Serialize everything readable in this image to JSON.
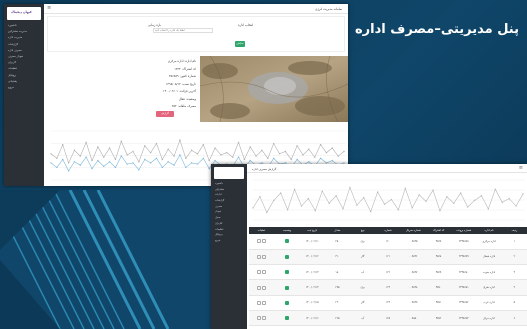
{
  "banner": {
    "title": "پنل مدیریتی–مصرف اداره"
  },
  "shot1": {
    "logo_text": "کیهان دیجیتال",
    "topbar_title": "سامانه مدیریت انرژی",
    "menu": [
      "داشبورد",
      "مدیریت مشترکین",
      "مدیریت اداره",
      "گزارشات",
      "مصرف اداره",
      "نمودار مصرف",
      "کاربران",
      "تنظیمات",
      "پروفایل",
      "پشتیبانی",
      "خروج"
    ],
    "form": {
      "label_unit": "انتخاب اداره",
      "label_date": "بازه زمانی",
      "input_value": "لطفا یک اداره را انتخاب کنید",
      "submit_label": "نمایش"
    },
    "info": {
      "lines": [
        "نام اداره: اداره مرکزی",
        "کد اشتراک: ۱۲۳۴",
        "شماره کنتور: ۴۵۶۷۸۹",
        "تاریخ نصب: ۱۳۹۸/۰۵/۱۲",
        "آخرین قرائت: ۱۴۰۰/۰۳/۰۱",
        "وضعیت: فعال",
        "مصرف ماهانه: ۲۵۴"
      ],
      "button_label": "گزارش"
    },
    "chart_data": {
      "type": "line",
      "series": [
        {
          "values": [
            52,
            48,
            60,
            44,
            55,
            50,
            62,
            46,
            58,
            49,
            57,
            47,
            63,
            51,
            54,
            45,
            59,
            53,
            61,
            47,
            56,
            50,
            64,
            48,
            55,
            52,
            60,
            46,
            57,
            51,
            53,
            49,
            62,
            47,
            58,
            50,
            55,
            48,
            61,
            52,
            54,
            47,
            59,
            51,
            56,
            49,
            60,
            53,
            57,
            50,
            54
          ]
        },
        {
          "values": [
            44,
            40,
            47,
            37,
            45,
            42,
            49,
            39,
            46,
            41,
            45,
            40,
            50,
            43,
            44,
            38,
            47,
            44,
            48,
            40,
            45,
            42,
            51,
            40,
            44,
            43,
            48,
            39,
            46,
            42,
            43,
            41,
            49,
            40,
            46,
            42,
            44,
            40,
            48,
            43,
            44,
            40,
            47,
            42,
            45,
            41,
            48,
            44,
            46,
            42,
            44
          ]
        }
      ]
    }
  },
  "shot2": {
    "topbar_title": "گزارش مصرف اداره",
    "menu": [
      "داشبورد",
      "مشترکین",
      "ادارات",
      "گزارشات",
      "مصرف",
      "نمودار",
      "جدول",
      "کاربران",
      "تنظیمات",
      "پروفایل",
      "خروج"
    ],
    "chart_data": {
      "type": "line",
      "series": [
        {
          "values": [
            50,
            62,
            45,
            58,
            66,
            48,
            70,
            52,
            60,
            47,
            68,
            55,
            63,
            49,
            72,
            53,
            61,
            46,
            67,
            54,
            59,
            48,
            71,
            50,
            64,
            57,
            69,
            47,
            62,
            55,
            66,
            51,
            58,
            63,
            49,
            70,
            56,
            60,
            52,
            65
          ]
        }
      ]
    },
    "table": {
      "headers": [
        "عملیات",
        "وضعیت",
        "تاریخ ثبت",
        "مقدار",
        "نوع",
        "شماره",
        "شماره سریال",
        "کد اشتراک",
        "شماره پرونده",
        "نام اداره",
        "ردیف"
      ],
      "rows": [
        [
          "",
          "",
          "۱۴۰۰/۰۲/۱۱",
          "۲۵۰",
          "برق",
          "۱۲۰",
          "۰۰۹۸۴۵",
          "۴۵۶۷",
          "۲۳۴۵۶۷۸",
          "اداره مرکزی",
          "۱"
        ],
        [
          "",
          "",
          "۱۴۰۰/۰۲/۱۲",
          "۳۱۰",
          "گاز",
          "۱۲۱",
          "۰۰۹۸۴۶",
          "۴۵۶۸",
          "۲۳۴۵۶۷۹",
          "اداره شمال",
          "۲"
        ],
        [
          "",
          "",
          "۱۴۰۰/۰۲/۱۳",
          "۱۸۰",
          "آب",
          "۱۲۲",
          "۰۰۹۸۴۷",
          "۴۵۶۹",
          "۲۳۴۵۶۸۰",
          "اداره جنوب",
          "۳"
        ],
        [
          "",
          "",
          "۱۴۰۰/۰۲/۱۴",
          "۲۹۵",
          "برق",
          "۱۲۳",
          "۰۰۹۸۴۸",
          "۴۵۷۰",
          "۲۳۴۵۶۸۱",
          "اداره شرق",
          "۴"
        ],
        [
          "",
          "",
          "۱۴۰۰/۰۲/۱۵",
          "۲۲۰",
          "گاز",
          "۱۲۴",
          "۰۰۹۸۴۹",
          "۴۵۷۱",
          "۲۳۴۵۶۸۲",
          "اداره غرب",
          "۵"
        ],
        [
          "",
          "",
          "۱۴۰۰/۰۲/۱۶",
          "۲۶۵",
          "آب",
          "۱۲۵",
          "۰۰۹۸۵۰",
          "۴۵۷۲",
          "۲۳۴۵۶۸۳",
          "اداره مرکز",
          "۶"
        ]
      ]
    }
  }
}
